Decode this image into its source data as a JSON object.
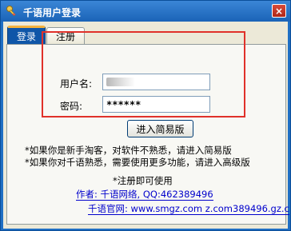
{
  "window": {
    "title": "千语用户登录",
    "close_label": "×"
  },
  "tabs": [
    {
      "label": "登录",
      "active": true
    },
    {
      "label": "注册",
      "active": false
    }
  ],
  "login_form": {
    "username_label": "用户名:",
    "password_label": "密码:",
    "password_value": "******",
    "simple_button_label": "进入简易版"
  },
  "notes": {
    "line1": "*如果你是新手淘客，对软件不熟悉，请进入简易版",
    "line2": "*如果你对千语熟悉，需要使用更多功能，请进入高级版",
    "line3": "*注册即可使用"
  },
  "links": {
    "author": "作者: 千语网络, QQ:462389496",
    "site": "千语官网: www.smgz.com z.com389496.gz.c"
  },
  "colors": {
    "title_bar": "#1a63b7",
    "highlight_border": "#e0312a",
    "link": "#0000cc",
    "active_tab": "#0f56a8"
  },
  "icons": {
    "app": "key-icon",
    "close": "close-icon"
  }
}
